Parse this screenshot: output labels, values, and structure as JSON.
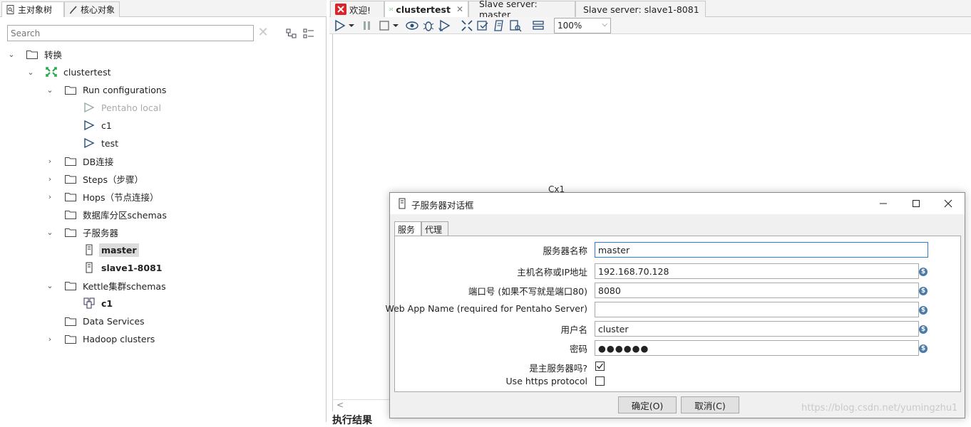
{
  "left_panel": {
    "tabs": [
      {
        "label": "主对象树",
        "icon": "tree-doc-icon"
      },
      {
        "label": "核心对象",
        "icon": "pencil-icon"
      }
    ],
    "search": {
      "placeholder": "Search",
      "value": ""
    },
    "tree": [
      {
        "label": "转换",
        "icon": "folder-icon",
        "twisty": "expanded"
      },
      {
        "label": "clustertest",
        "icon": "transformation-icon",
        "twisty": "expanded"
      },
      {
        "label": "Run configurations",
        "icon": "folder-icon",
        "twisty": "expanded"
      },
      {
        "label": "Pentaho local",
        "icon": "run-icon",
        "twisty": "none"
      },
      {
        "label": "c1",
        "icon": "run-icon",
        "twisty": "none"
      },
      {
        "label": "test",
        "icon": "run-icon",
        "twisty": "none"
      },
      {
        "label": "DB连接",
        "icon": "folder-icon",
        "twisty": "collapsed"
      },
      {
        "label": "Steps（步骤）",
        "icon": "folder-icon",
        "twisty": "collapsed"
      },
      {
        "label": "Hops（节点连接）",
        "icon": "folder-icon",
        "twisty": "collapsed"
      },
      {
        "label": "数据库分区schemas",
        "icon": "folder-icon",
        "twisty": "none"
      },
      {
        "label": "子服务器",
        "icon": "folder-icon",
        "twisty": "expanded"
      },
      {
        "label": "master",
        "icon": "server-icon",
        "twisty": "none"
      },
      {
        "label": "slave1-8081",
        "icon": "server-icon",
        "twisty": "none"
      },
      {
        "label": "Kettle集群schemas",
        "icon": "folder-icon",
        "twisty": "expanded"
      },
      {
        "label": "c1",
        "icon": "cluster-icon",
        "twisty": "none"
      },
      {
        "label": "Data Services",
        "icon": "folder-icon",
        "twisty": "none"
      },
      {
        "label": "Hadoop clusters",
        "icon": "folder-icon",
        "twisty": "collapsed"
      }
    ]
  },
  "right_area": {
    "tabs": [
      {
        "label": "欢迎!",
        "icon": "spoon-logo-icon",
        "active": false
      },
      {
        "label": "clustertest",
        "icon": "transformation-icon",
        "active": true,
        "close": "✕"
      },
      {
        "label": "Slave server: master",
        "active": false
      },
      {
        "label": "Slave server: slave1-8081",
        "active": false
      }
    ],
    "zoom": "100%",
    "canvas_label": "Cx1",
    "scroll_left": "<",
    "exec_label": "执行结果"
  },
  "dialog": {
    "title": "子服务器对话框",
    "tabs": [
      "服务",
      "代理"
    ],
    "fields": {
      "server_name": {
        "label": "服务器名称",
        "value": "master"
      },
      "host": {
        "label": "主机名称或IP地址",
        "value": "192.168.70.128"
      },
      "port": {
        "label": "端口号 (如果不写就是端口80)",
        "value": "8080"
      },
      "webapp": {
        "label": "Web App Name (required for Pentaho Server)",
        "value": ""
      },
      "username": {
        "label": "用户名",
        "value": "cluster"
      },
      "password": {
        "label": "密码",
        "value": "●●●●●●"
      },
      "is_master": {
        "label": "是主服务器吗?",
        "checked": true
      },
      "use_https": {
        "label": "Use https protocol",
        "checked": false
      }
    },
    "buttons": {
      "ok": "确定(O)",
      "cancel": "取消(C)"
    }
  },
  "watermark": "https://blog.csdn.net/yumingzhu1"
}
